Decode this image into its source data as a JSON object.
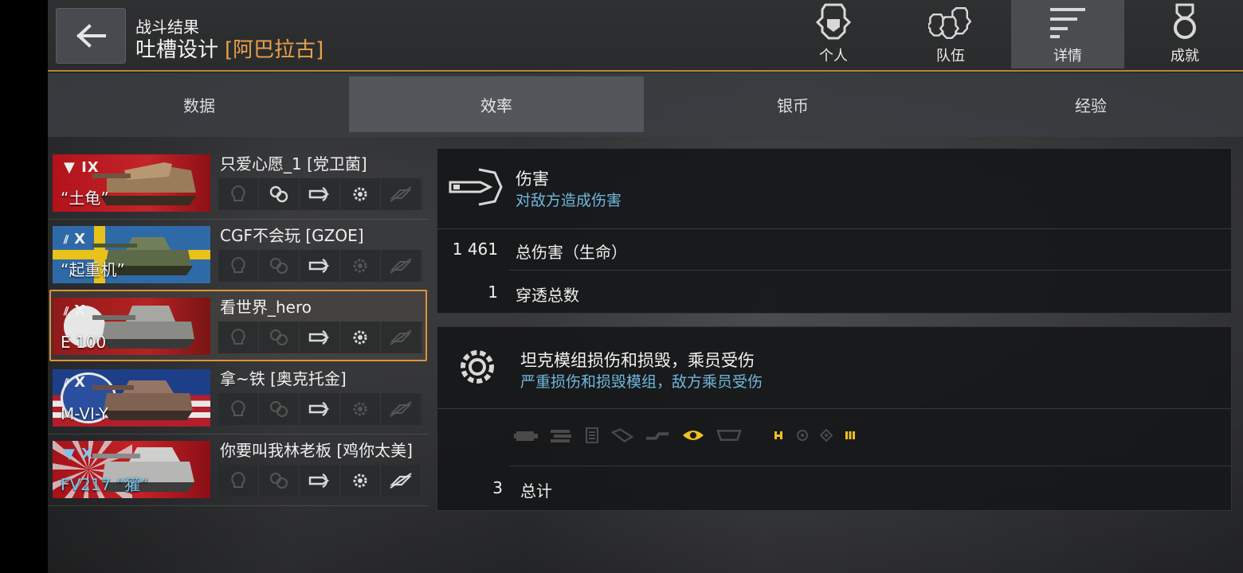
{
  "header": {
    "subtitle": "战斗结果",
    "title": "吐槽设计",
    "clan": "[阿巴拉古]",
    "tabs": [
      {
        "label": "个人",
        "icon": "person-helmet-icon"
      },
      {
        "label": "队伍",
        "icon": "team-helmet-icon"
      },
      {
        "label": "详情",
        "icon": "details-lines-icon",
        "active": true
      },
      {
        "label": "成就",
        "icon": "medal-icon"
      }
    ]
  },
  "subtabs": [
    {
      "label": "数据"
    },
    {
      "label": "效率",
      "active": true
    },
    {
      "label": "银币"
    },
    {
      "label": "经验"
    }
  ],
  "players": [
    {
      "name": "只爱心愿_1 [党卫菌]",
      "tier": "▼ IX",
      "tank": "“土龟”",
      "flag": "red"
    },
    {
      "name": "CGF不会玩 [GZOE]",
      "tier": "X",
      "tank": "“起重机”",
      "flag": "sweden"
    },
    {
      "name": "看世界_hero",
      "tier": "X",
      "tank": "E 100",
      "flag": "germany",
      "selected": true
    },
    {
      "name": "拿~铁 [奥克托金]",
      "tier": "X",
      "tank": "M-VI-Y",
      "flag": "usa"
    },
    {
      "name": "你要叫我林老板 [鸡你太美]",
      "tier": "▼ X",
      "tank": "FV217 “獾”",
      "flag": "uk"
    }
  ],
  "damage_panel": {
    "title": "伤害",
    "desc": "对敌方造成伤害",
    "rows": [
      {
        "value": "1 461",
        "label": "总伤害（生命）"
      },
      {
        "value": "1",
        "label": "穿透总数"
      }
    ]
  },
  "modules_panel": {
    "title": "坦克模组损伤和损毁，乘员受伤",
    "desc": "严重损伤和损毁模组，敌方乘员受伤",
    "total_value": "3",
    "total_label": "总计"
  },
  "colors": {
    "accent": "#e0923a",
    "link_blue": "#6fb8dd",
    "active_icon": "#f0c020"
  }
}
